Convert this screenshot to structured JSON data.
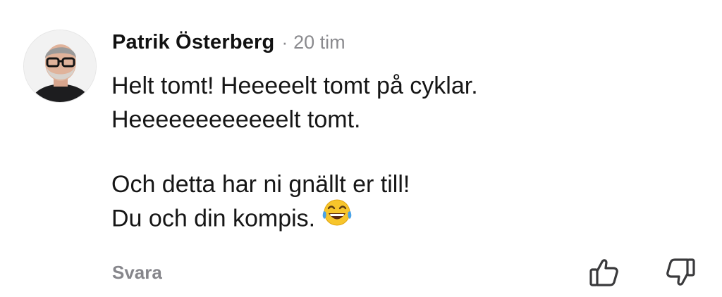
{
  "comment": {
    "author": "Patrik Österberg",
    "separator": "·",
    "time": "20 tim",
    "lines": [
      "Helt tomt! Heeeeelt tomt på cyklar.",
      "Heeeeeeeeeeeelt tomt.",
      "",
      "Och detta har ni gnällt er till!",
      "Du och din kompis."
    ],
    "emoji": "face-with-tears-of-joy",
    "avatar": "profile-photo"
  },
  "actions": {
    "reply_label": "Svara",
    "like_icon": "thumbs-up-icon",
    "dislike_icon": "thumbs-down-icon"
  },
  "colors": {
    "text": "#161616",
    "muted": "#86868b",
    "background": "#ffffff"
  }
}
